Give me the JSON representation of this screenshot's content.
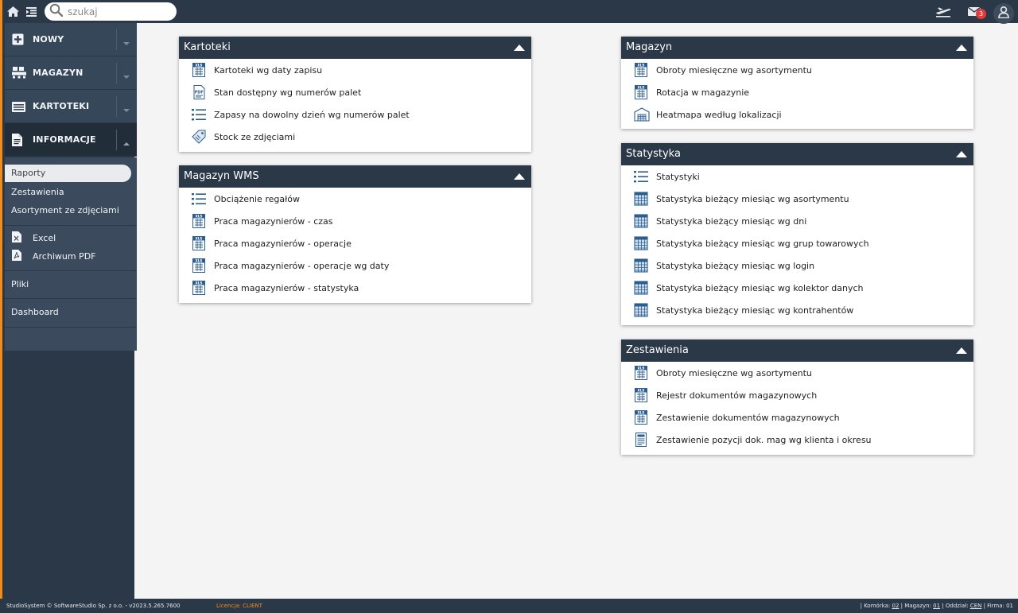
{
  "colors": {
    "sidebar": "#2b3848",
    "accent": "#f08c1c",
    "panel_header": "#2b3848",
    "icon_blue": "#2c5d8f",
    "badge": "#e23b3b"
  },
  "topbar": {
    "icons": [
      "home-icon",
      "indent-list-icon",
      "search-icon",
      "plane-icon",
      "mail-icon",
      "user-icon"
    ],
    "search_placeholder": "szukaj",
    "mail_badge": "3"
  },
  "sidebar": {
    "menu": [
      {
        "label": "NOWY",
        "icon": "plus-square-icon"
      },
      {
        "label": "MAGAZYN",
        "icon": "forklift-icon"
      },
      {
        "label": "KARTOTEKI",
        "icon": "card-icon"
      },
      {
        "label": "INFORMACJE",
        "icon": "document-icon"
      }
    ],
    "sub": {
      "raporty": "Raporty",
      "zestawienia": "Zestawienia",
      "asortyment": "Asortyment ze zdjęciami",
      "excel": "Excel",
      "archiwum": "Archiwum PDF",
      "pliki": "Pliki",
      "dashboard": "Dashboard"
    }
  },
  "panels": {
    "kartoteki": {
      "title": "Kartoteki",
      "items": [
        {
          "label": "Kartoteki wg daty zapisu",
          "icon": "xls-icon"
        },
        {
          "label": "Stan dostępny wg numerów palet",
          "icon": "pdf-icon"
        },
        {
          "label": "Zapasy na dowolny dzień wg numerów palet",
          "icon": "list-icon"
        },
        {
          "label": "Stock ze zdjęciami",
          "icon": "tag-icon"
        }
      ]
    },
    "wms": {
      "title": "Magazyn WMS",
      "items": [
        {
          "label": "Obciążenie regałów",
          "icon": "list-icon"
        },
        {
          "label": "Praca magazynierów - czas",
          "icon": "xls-icon"
        },
        {
          "label": "Praca magazynierów - operacje",
          "icon": "xls-icon"
        },
        {
          "label": "Praca magazynierów - operacje wg daty",
          "icon": "xls-icon"
        },
        {
          "label": "Praca magazynierów - statystyka",
          "icon": "xls-icon"
        }
      ]
    },
    "magazyn": {
      "title": "Magazyn",
      "items": [
        {
          "label": "Obroty miesięczne wg asortymentu",
          "icon": "xls-icon"
        },
        {
          "label": "Rotacja w magazynie",
          "icon": "xls-icon"
        },
        {
          "label": "Heatmapa według lokalizacji",
          "icon": "warehouse-icon"
        }
      ]
    },
    "statystyka": {
      "title": "Statystyka",
      "items": [
        {
          "label": "Statystyki",
          "icon": "list-icon"
        },
        {
          "label": "Statystyka bieżący miesiąc wg asortymentu",
          "icon": "table-icon"
        },
        {
          "label": "Statystyka bieżący miesiąc wg dni",
          "icon": "table-icon"
        },
        {
          "label": "Statystyka bieżący miesiąc wg grup towarowych",
          "icon": "table-icon"
        },
        {
          "label": "Statystyka bieżący miesiąc wg login",
          "icon": "table-icon"
        },
        {
          "label": "Statystyka bieżący miesiąc wg kolektor danych",
          "icon": "table-icon"
        },
        {
          "label": "Statystyka bieżący miesiąc wg kontrahentów",
          "icon": "table-icon"
        }
      ]
    },
    "zestawienia": {
      "title": "Zestawienia",
      "items": [
        {
          "label": "Obroty miesięczne wg asortymentu",
          "icon": "xls-icon"
        },
        {
          "label": "Rejestr dokumentów magazynowych",
          "icon": "xls-icon"
        },
        {
          "label": "Zestawienie dokumentów magazynowych",
          "icon": "xls-icon"
        },
        {
          "label": "Zestawienie pozycji dok. mag wg klienta i okresu",
          "icon": "report-icon"
        }
      ]
    }
  },
  "footer": {
    "copyright": "StudioSystem © SoftwareStudio Sp. z o.o. - v2023.5.265.7600",
    "license": "Licencja: CLIENT",
    "komorka_label": "| Komórka:",
    "komorka_value": "02",
    "magazyn_label": "| Magazyn:",
    "magazyn_value": "01",
    "oddzial_label": "| Oddział:",
    "oddzial_value": "CEN",
    "firma_label": "| Firma: 01"
  }
}
